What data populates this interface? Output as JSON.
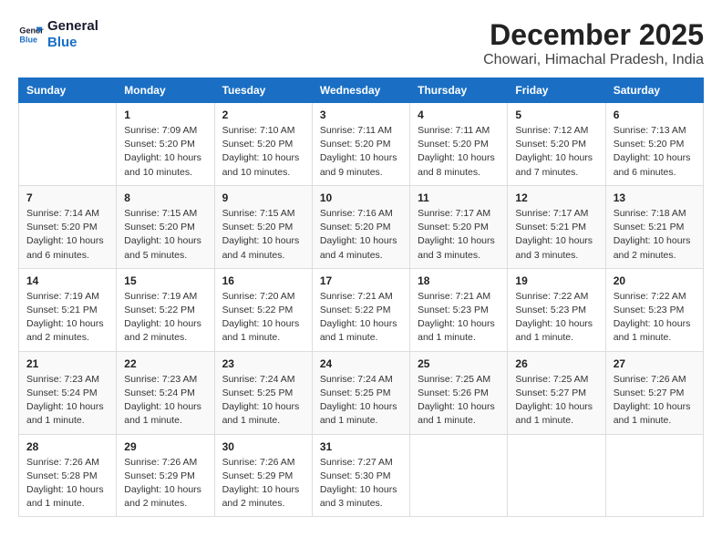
{
  "header": {
    "logo_line1": "General",
    "logo_line2": "Blue",
    "month_title": "December 2025",
    "location": "Chowari, Himachal Pradesh, India"
  },
  "weekdays": [
    "Sunday",
    "Monday",
    "Tuesday",
    "Wednesday",
    "Thursday",
    "Friday",
    "Saturday"
  ],
  "weeks": [
    [
      {
        "day": "",
        "info": ""
      },
      {
        "day": "1",
        "info": "Sunrise: 7:09 AM\nSunset: 5:20 PM\nDaylight: 10 hours\nand 10 minutes."
      },
      {
        "day": "2",
        "info": "Sunrise: 7:10 AM\nSunset: 5:20 PM\nDaylight: 10 hours\nand 10 minutes."
      },
      {
        "day": "3",
        "info": "Sunrise: 7:11 AM\nSunset: 5:20 PM\nDaylight: 10 hours\nand 9 minutes."
      },
      {
        "day": "4",
        "info": "Sunrise: 7:11 AM\nSunset: 5:20 PM\nDaylight: 10 hours\nand 8 minutes."
      },
      {
        "day": "5",
        "info": "Sunrise: 7:12 AM\nSunset: 5:20 PM\nDaylight: 10 hours\nand 7 minutes."
      },
      {
        "day": "6",
        "info": "Sunrise: 7:13 AM\nSunset: 5:20 PM\nDaylight: 10 hours\nand 6 minutes."
      }
    ],
    [
      {
        "day": "7",
        "info": "Sunrise: 7:14 AM\nSunset: 5:20 PM\nDaylight: 10 hours\nand 6 minutes."
      },
      {
        "day": "8",
        "info": "Sunrise: 7:15 AM\nSunset: 5:20 PM\nDaylight: 10 hours\nand 5 minutes."
      },
      {
        "day": "9",
        "info": "Sunrise: 7:15 AM\nSunset: 5:20 PM\nDaylight: 10 hours\nand 4 minutes."
      },
      {
        "day": "10",
        "info": "Sunrise: 7:16 AM\nSunset: 5:20 PM\nDaylight: 10 hours\nand 4 minutes."
      },
      {
        "day": "11",
        "info": "Sunrise: 7:17 AM\nSunset: 5:20 PM\nDaylight: 10 hours\nand 3 minutes."
      },
      {
        "day": "12",
        "info": "Sunrise: 7:17 AM\nSunset: 5:21 PM\nDaylight: 10 hours\nand 3 minutes."
      },
      {
        "day": "13",
        "info": "Sunrise: 7:18 AM\nSunset: 5:21 PM\nDaylight: 10 hours\nand 2 minutes."
      }
    ],
    [
      {
        "day": "14",
        "info": "Sunrise: 7:19 AM\nSunset: 5:21 PM\nDaylight: 10 hours\nand 2 minutes."
      },
      {
        "day": "15",
        "info": "Sunrise: 7:19 AM\nSunset: 5:22 PM\nDaylight: 10 hours\nand 2 minutes."
      },
      {
        "day": "16",
        "info": "Sunrise: 7:20 AM\nSunset: 5:22 PM\nDaylight: 10 hours\nand 1 minute."
      },
      {
        "day": "17",
        "info": "Sunrise: 7:21 AM\nSunset: 5:22 PM\nDaylight: 10 hours\nand 1 minute."
      },
      {
        "day": "18",
        "info": "Sunrise: 7:21 AM\nSunset: 5:23 PM\nDaylight: 10 hours\nand 1 minute."
      },
      {
        "day": "19",
        "info": "Sunrise: 7:22 AM\nSunset: 5:23 PM\nDaylight: 10 hours\nand 1 minute."
      },
      {
        "day": "20",
        "info": "Sunrise: 7:22 AM\nSunset: 5:23 PM\nDaylight: 10 hours\nand 1 minute."
      }
    ],
    [
      {
        "day": "21",
        "info": "Sunrise: 7:23 AM\nSunset: 5:24 PM\nDaylight: 10 hours\nand 1 minute."
      },
      {
        "day": "22",
        "info": "Sunrise: 7:23 AM\nSunset: 5:24 PM\nDaylight: 10 hours\nand 1 minute."
      },
      {
        "day": "23",
        "info": "Sunrise: 7:24 AM\nSunset: 5:25 PM\nDaylight: 10 hours\nand 1 minute."
      },
      {
        "day": "24",
        "info": "Sunrise: 7:24 AM\nSunset: 5:25 PM\nDaylight: 10 hours\nand 1 minute."
      },
      {
        "day": "25",
        "info": "Sunrise: 7:25 AM\nSunset: 5:26 PM\nDaylight: 10 hours\nand 1 minute."
      },
      {
        "day": "26",
        "info": "Sunrise: 7:25 AM\nSunset: 5:27 PM\nDaylight: 10 hours\nand 1 minute."
      },
      {
        "day": "27",
        "info": "Sunrise: 7:26 AM\nSunset: 5:27 PM\nDaylight: 10 hours\nand 1 minute."
      }
    ],
    [
      {
        "day": "28",
        "info": "Sunrise: 7:26 AM\nSunset: 5:28 PM\nDaylight: 10 hours\nand 1 minute."
      },
      {
        "day": "29",
        "info": "Sunrise: 7:26 AM\nSunset: 5:29 PM\nDaylight: 10 hours\nand 2 minutes."
      },
      {
        "day": "30",
        "info": "Sunrise: 7:26 AM\nSunset: 5:29 PM\nDaylight: 10 hours\nand 2 minutes."
      },
      {
        "day": "31",
        "info": "Sunrise: 7:27 AM\nSunset: 5:30 PM\nDaylight: 10 hours\nand 3 minutes."
      },
      {
        "day": "",
        "info": ""
      },
      {
        "day": "",
        "info": ""
      },
      {
        "day": "",
        "info": ""
      }
    ]
  ]
}
